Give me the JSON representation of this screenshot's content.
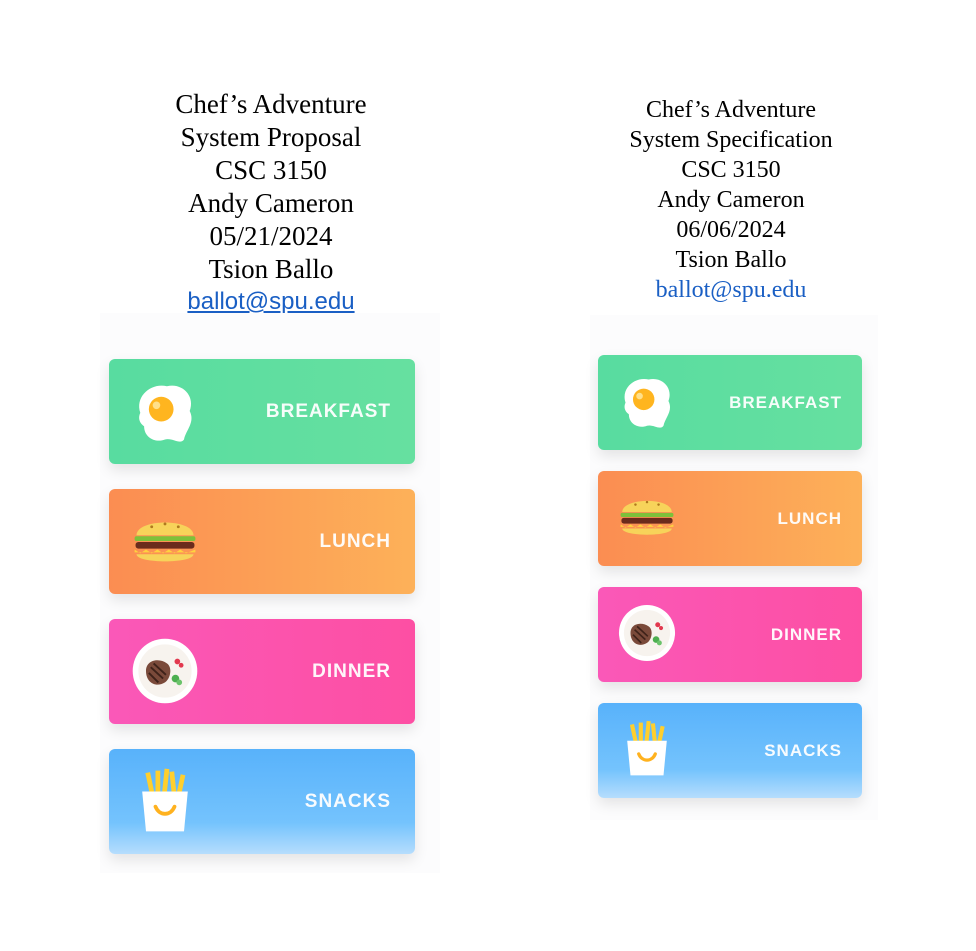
{
  "left_document": {
    "header": {
      "title": "Chef’s Adventure",
      "subtitle": "System Proposal",
      "course": "CSC 3150",
      "instructor": "Andy Cameron",
      "date": "05/21/2024",
      "author": "Tsion Ballo",
      "email": "ballot@spu.edu"
    },
    "menu": [
      {
        "label": "BREAKFAST",
        "icon": "fried-egg-icon"
      },
      {
        "label": "LUNCH",
        "icon": "burger-icon"
      },
      {
        "label": "DINNER",
        "icon": "steak-plate-icon"
      },
      {
        "label": "SNACKS",
        "icon": "fries-icon"
      }
    ]
  },
  "right_document": {
    "header": {
      "title": "Chef’s Adventure",
      "subtitle": "System Specification",
      "course": "CSC 3150",
      "instructor": "Andy Cameron",
      "date": "06/06/2024",
      "author": "Tsion Ballo",
      "email": "ballot@spu.edu"
    },
    "menu": [
      {
        "label": "BREAKFAST",
        "icon": "fried-egg-icon"
      },
      {
        "label": "LUNCH",
        "icon": "burger-icon"
      },
      {
        "label": "DINNER",
        "icon": "steak-plate-icon"
      },
      {
        "label": "SNACKS",
        "icon": "fries-icon"
      }
    ]
  },
  "colors": {
    "breakfast": "#5edd9f",
    "lunch": "#fc9d55",
    "dinner": "#fb54ad",
    "snacks": "#62b9fc",
    "link": "#1a5fc4"
  }
}
